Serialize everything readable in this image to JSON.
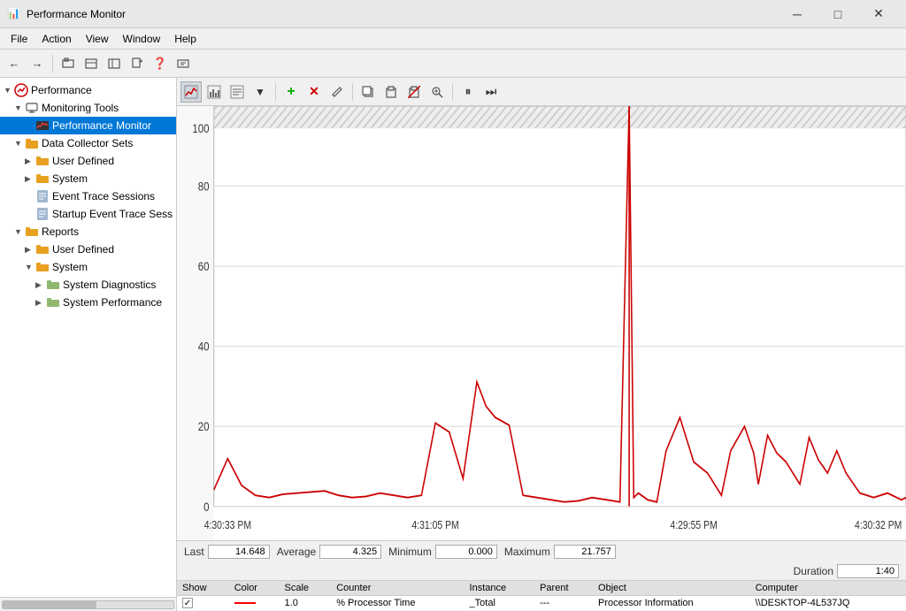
{
  "titleBar": {
    "icon": "📊",
    "title": "Performance Monitor",
    "minimize": "─",
    "maximize": "□",
    "close": "✕"
  },
  "menuBar": {
    "items": [
      "File",
      "Action",
      "View",
      "Window",
      "Help"
    ]
  },
  "toolbar": {
    "buttons": [
      "←",
      "→",
      "📁",
      "📋",
      "🗑",
      "📋",
      "🖨",
      "❓",
      "📊"
    ]
  },
  "leftPanel": {
    "root": "Performance",
    "tree": [
      {
        "level": 1,
        "label": "Monitoring Tools",
        "icon": "🔧",
        "expanded": true,
        "arrow": "▼"
      },
      {
        "level": 2,
        "label": "Performance Monitor",
        "icon": "📈",
        "selected": true,
        "arrow": ""
      },
      {
        "level": 1,
        "label": "Data Collector Sets",
        "icon": "📁",
        "expanded": true,
        "arrow": "▼"
      },
      {
        "level": 2,
        "label": "User Defined",
        "icon": "📁",
        "expanded": false,
        "arrow": "▶"
      },
      {
        "level": 2,
        "label": "System",
        "icon": "📁",
        "expanded": false,
        "arrow": "▶"
      },
      {
        "level": 2,
        "label": "Event Trace Sessions",
        "icon": "📄",
        "expanded": false,
        "arrow": ""
      },
      {
        "level": 2,
        "label": "Startup Event Trace Sess",
        "icon": "📄",
        "expanded": false,
        "arrow": ""
      },
      {
        "level": 1,
        "label": "Reports",
        "icon": "📁",
        "expanded": true,
        "arrow": "▼"
      },
      {
        "level": 2,
        "label": "User Defined",
        "icon": "📁",
        "expanded": false,
        "arrow": "▶"
      },
      {
        "level": 2,
        "label": "System",
        "icon": "📁",
        "expanded": true,
        "arrow": "▼"
      },
      {
        "level": 3,
        "label": "System Diagnostics",
        "icon": "📋",
        "expanded": false,
        "arrow": "▶"
      },
      {
        "level": 3,
        "label": "System Performance",
        "icon": "📋",
        "expanded": false,
        "arrow": "▶"
      }
    ]
  },
  "chartToolbar": {
    "buttons": [
      {
        "label": "📈",
        "name": "chart-view-btn",
        "active": true
      },
      {
        "label": "📊",
        "name": "histogram-btn",
        "active": false
      },
      {
        "label": "📋",
        "name": "report-btn",
        "active": false
      },
      {
        "label": "▼",
        "name": "dropdown-btn",
        "active": false
      }
    ],
    "actions": [
      {
        "label": "+",
        "name": "add-counter-btn"
      },
      {
        "label": "✕",
        "name": "remove-counter-btn"
      },
      {
        "label": "✏",
        "name": "properties-btn"
      },
      {
        "label": "⧉",
        "name": "copy-image-btn"
      },
      {
        "label": "🗑",
        "name": "clear-btn"
      },
      {
        "label": "⧉",
        "name": "paste-btn"
      },
      {
        "label": "🔍",
        "name": "zoom-btn"
      }
    ],
    "controls": [
      {
        "label": "⏸",
        "name": "freeze-btn"
      },
      {
        "label": "⏭",
        "name": "next-btn"
      }
    ]
  },
  "chart": {
    "yAxis": {
      "max": 100,
      "marks": [
        100,
        80,
        60,
        40,
        20,
        0
      ]
    },
    "xAxis": {
      "labels": [
        "4:30:33 PM",
        "4:31:05 PM",
        "4:29:55 PM",
        "4:30:32 PM"
      ]
    },
    "lineColor": "#cc0000",
    "verticalLineColor": "#cc0000"
  },
  "stats": {
    "last_label": "Last",
    "last_value": "14.648",
    "average_label": "Average",
    "average_value": "4.325",
    "minimum_label": "Minimum",
    "minimum_value": "0.000",
    "maximum_label": "Maximum",
    "maximum_value": "21.757",
    "duration_label": "Duration",
    "duration_value": "1:40"
  },
  "counterTable": {
    "headers": [
      "Show",
      "Color",
      "Scale",
      "Counter",
      "Instance",
      "Parent",
      "Object",
      "Computer"
    ],
    "rows": [
      {
        "show": "✓",
        "color": "red-line",
        "scale": "1.0",
        "counter": "% Processor Time",
        "instance": "_Total",
        "parent": "---",
        "object": "Processor Information",
        "computer": "\\\\DESKTOP-4L537JQ"
      }
    ]
  }
}
